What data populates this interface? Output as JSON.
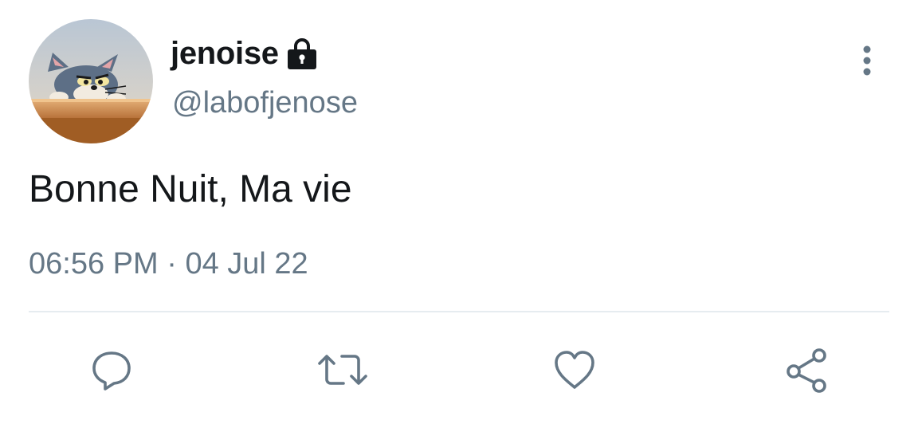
{
  "user": {
    "display_name": "jenoise",
    "handle": "@labofjenose",
    "protected_icon": "lock-icon",
    "avatar_icon": "cartoon-cat-avatar"
  },
  "tweet": {
    "text": "Bonne Nuit, Ma vie",
    "time": "06:56 PM",
    "separator": "·",
    "date": "04 Jul 22"
  },
  "actions": {
    "reply_icon": "reply-icon",
    "retweet_icon": "retweet-icon",
    "like_icon": "heart-icon",
    "share_icon": "share-icon"
  },
  "menu": {
    "more_icon": "more-vertical-icon"
  },
  "colors": {
    "primary_text": "#14171a",
    "secondary_text": "#657786",
    "divider": "#e6ecf0",
    "icon": "#657786"
  }
}
